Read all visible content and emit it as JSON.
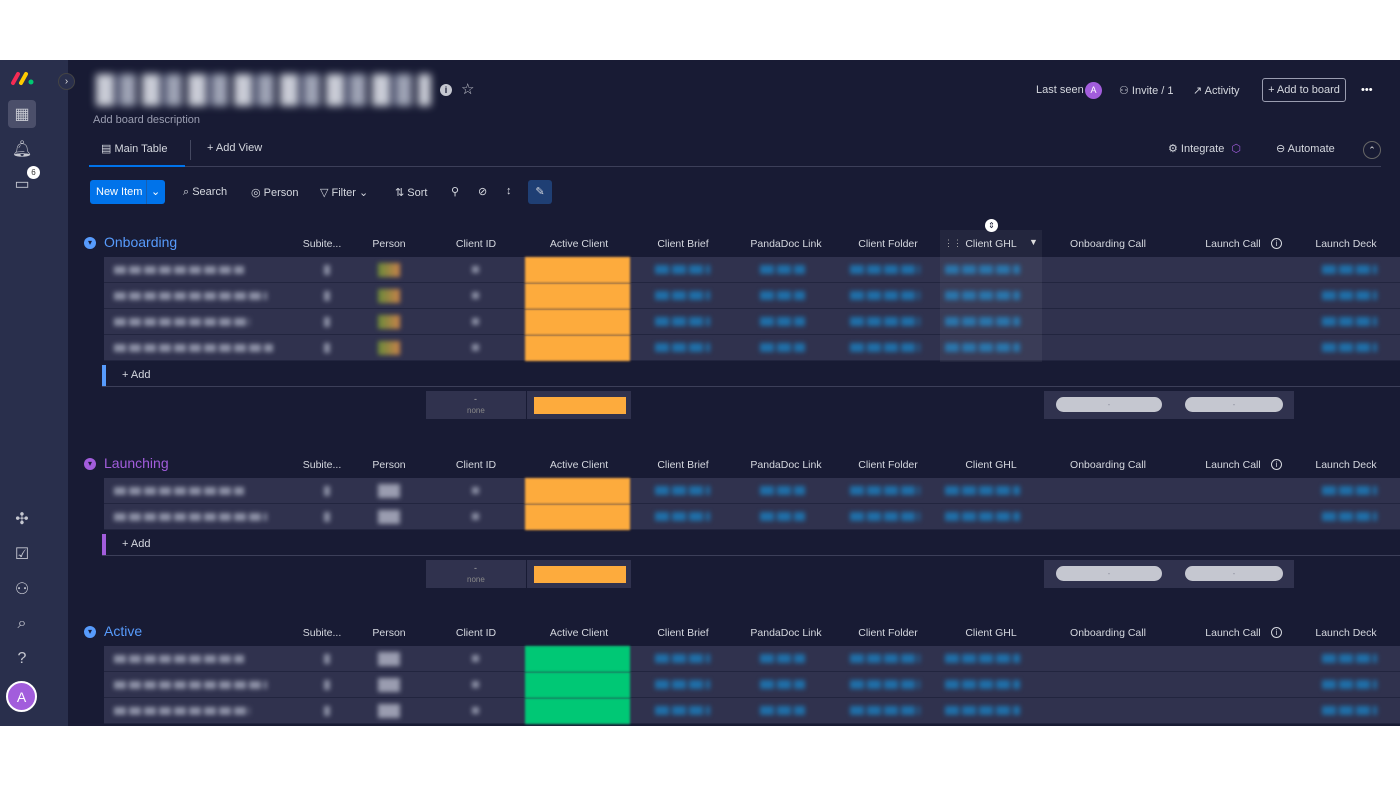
{
  "sidebar": {
    "notifications_badge": "6",
    "avatar_initial": "A"
  },
  "header": {
    "description": "Add board description",
    "last_seen": "Last seen",
    "last_seen_avatar": "A",
    "invite": "Invite / 1",
    "activity": "Activity",
    "add_to_board": "+ Add to board",
    "more": "•••"
  },
  "tabs": {
    "main_table": "Main Table",
    "add_view": "+ Add View",
    "integrate": "Integrate",
    "automate": "Automate"
  },
  "toolbar": {
    "new_item": "New Item",
    "search": "Search",
    "person": "Person",
    "filter": "Filter",
    "sort": "Sort"
  },
  "columns": [
    "Subite...",
    "Person",
    "Client ID",
    "Active Client",
    "Client Brief",
    "PandaDoc Link",
    "Client Folder",
    "Client GHL",
    "Onboarding Call",
    "Launch Call",
    "Launch Deck"
  ],
  "groups": [
    {
      "name": "Onboarding",
      "color": "#579bfc",
      "rows": 4,
      "status_color": "#fdab3d",
      "add_label": "+ Add",
      "summary_dash": "-",
      "summary_none": "none",
      "pill_label": "-"
    },
    {
      "name": "Launching",
      "color": "#a25ddc",
      "rows": 2,
      "status_color": "#fdab3d",
      "add_label": "+ Add",
      "summary_dash": "-",
      "summary_none": "none",
      "pill_label": "-"
    },
    {
      "name": "Active",
      "color": "#579bfc",
      "rows": 3,
      "status_color": "#00c875"
    }
  ]
}
